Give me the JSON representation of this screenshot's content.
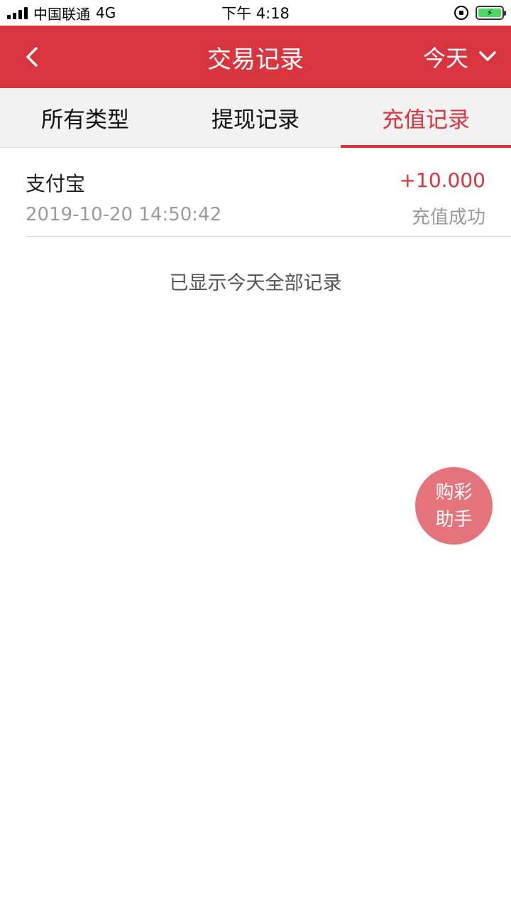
{
  "status_bar": {
    "carrier": "中国联通",
    "network": "4G",
    "time": "下午 4:18",
    "icons": [
      "signal-icon",
      "orientation-lock-icon",
      "battery-charging-icon"
    ],
    "battery_color": "#4cd964"
  },
  "header": {
    "title": "交易记录",
    "date_filter": "今天",
    "background": "#d8353f"
  },
  "tabs": [
    {
      "label": "所有类型",
      "active": false
    },
    {
      "label": "提现记录",
      "active": false
    },
    {
      "label": "充值记录",
      "active": true
    }
  ],
  "records": [
    {
      "name": "支付宝",
      "amount": "+10.000",
      "time": "2019-10-20 14:50:42",
      "status": "充值成功"
    }
  ],
  "end_note": "已显示今天全部记录",
  "helper_button": {
    "line1": "购彩",
    "line2": "助手",
    "color": "#e5737c"
  }
}
